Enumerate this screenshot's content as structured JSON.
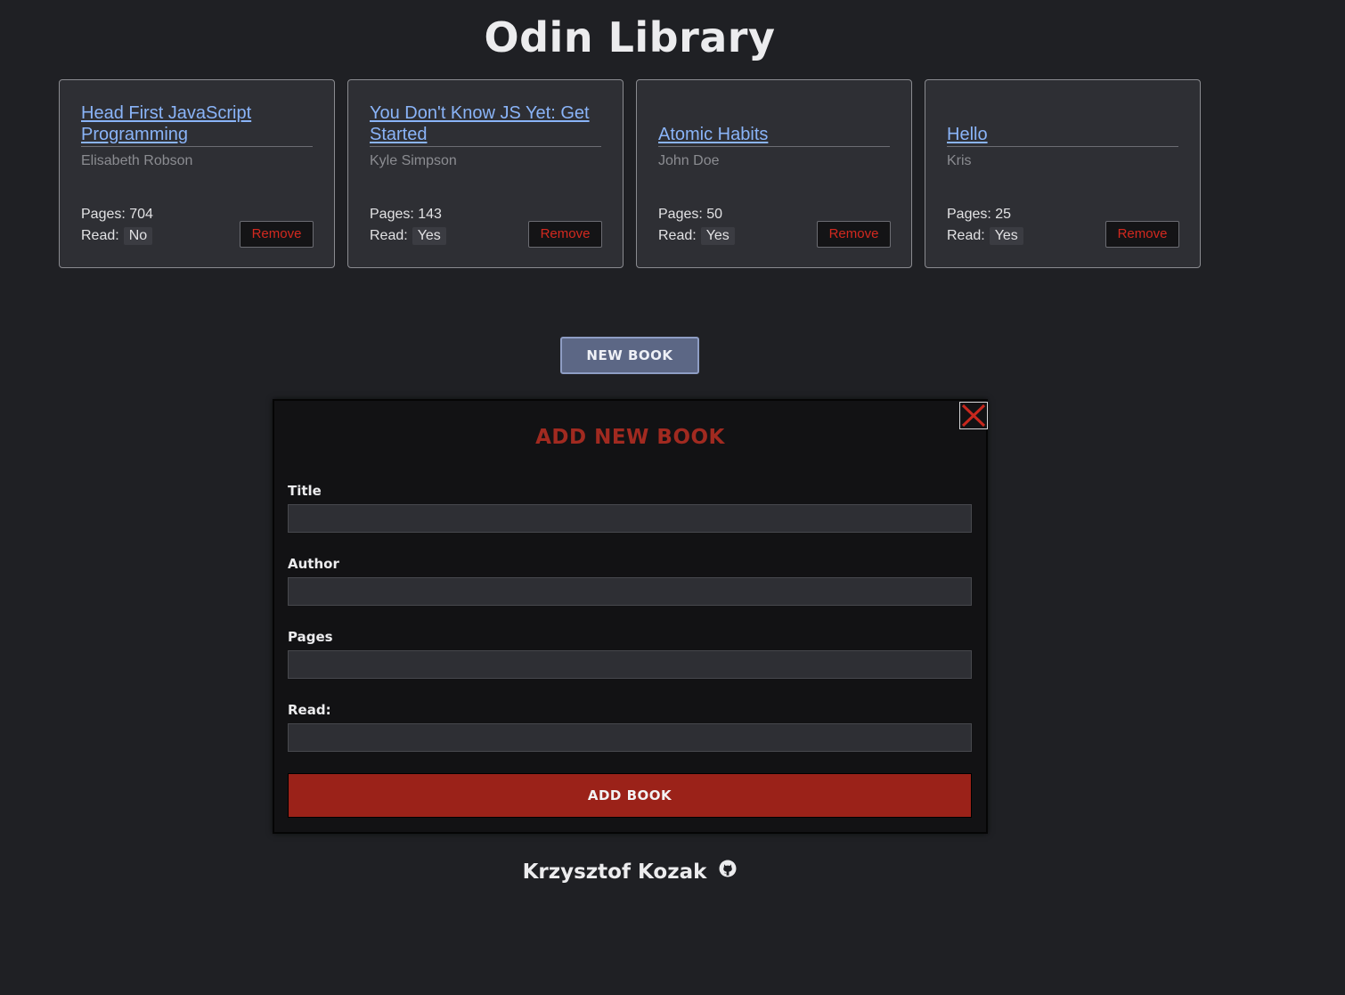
{
  "app": {
    "title": "Odin Library"
  },
  "books": [
    {
      "title": "Head First JavaScript Programming",
      "author": "Elisabeth Robson",
      "pages_label": "Pages: 704",
      "read_label": "Read:",
      "read_value": "No",
      "remove_label": "Remove"
    },
    {
      "title": "You Don't Know JS Yet: Get Started",
      "author": "Kyle Simpson",
      "pages_label": "Pages: 143",
      "read_label": "Read:",
      "read_value": "Yes",
      "remove_label": "Remove"
    },
    {
      "title": "Atomic Habits",
      "author": "John Doe",
      "pages_label": "Pages: 50",
      "read_label": "Read:",
      "read_value": "Yes",
      "remove_label": "Remove"
    },
    {
      "title": "Hello",
      "author": "Kris",
      "pages_label": "Pages: 25",
      "read_label": "Read:",
      "read_value": "Yes",
      "remove_label": "Remove"
    }
  ],
  "new_book_button": {
    "label": "NEW BOOK"
  },
  "dialog": {
    "title": "ADD NEW BOOK",
    "close_icon": "close-x-icon",
    "fields": {
      "title": {
        "label": "Title",
        "value": ""
      },
      "author": {
        "label": "Author",
        "value": ""
      },
      "pages": {
        "label": "Pages",
        "value": ""
      },
      "read": {
        "label": "Read:",
        "value": ""
      }
    },
    "submit_label": "ADD BOOK"
  },
  "footer": {
    "name": "Krzysztof Kozak",
    "icon": "github-icon"
  },
  "colors": {
    "background": "#1f2024",
    "card": "#2e2f34",
    "link": "#8ab4f8",
    "accent_red": "#9b2219",
    "remove_red": "#d3291f",
    "new_book_blue": "#5c6785"
  }
}
